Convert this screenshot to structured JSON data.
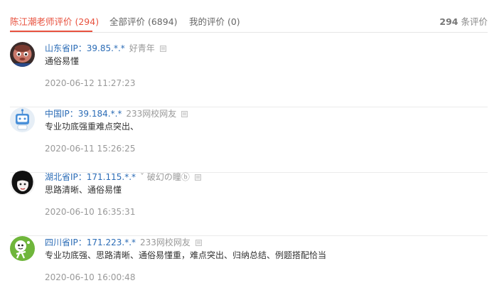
{
  "tabs": [
    {
      "label": "陈江潮老师评价 (294)",
      "active": true
    },
    {
      "label": "全部评价 (6894)",
      "active": false
    },
    {
      "label": "我的评价 (0)",
      "active": false
    }
  ],
  "summary": {
    "count": "294",
    "unit": "条评价"
  },
  "colors": {
    "accent": "#e8523f",
    "link": "#2b6cb6",
    "muted": "#999999"
  },
  "reviews": [
    {
      "ip": "山东省IP：39.85.*.*",
      "nickname": "好青年",
      "content": "通俗易懂",
      "date": "2020-06-12 11:27:23",
      "avatar": "cartoon-boy-avatar"
    },
    {
      "ip": "中国IP：39.184.*.*",
      "nickname": "233网校网友",
      "content": "专业功底强重难点突出、",
      "date": "2020-06-11 15:26:25",
      "avatar": "robot-default-avatar"
    },
    {
      "ip": "湖北省IP：171.115.*.*",
      "nickname": "ˇ 破幻の瞳ⓑ",
      "content": "思路清晰、通俗易懂",
      "date": "2020-06-10 16:35:31",
      "avatar": "black-hair-girl-avatar"
    },
    {
      "ip": "四川省IP：171.223.*.*",
      "nickname": "233网校网友",
      "content": "专业功底强、思路清晰、通俗易懂重，难点突出、归纳总结、例题搭配恰当",
      "date": "2020-06-10 16:00:48",
      "avatar": "green-cartoon-avatar"
    }
  ]
}
